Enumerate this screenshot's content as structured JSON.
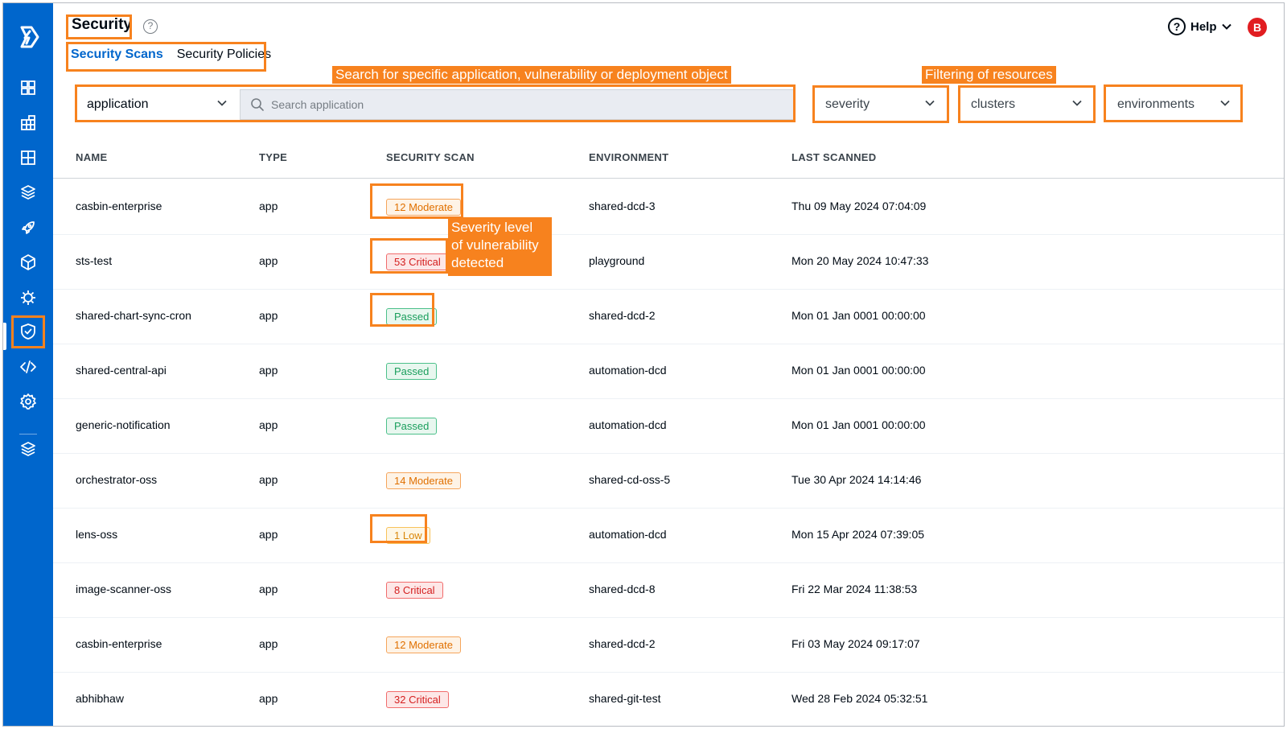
{
  "header": {
    "title": "Security",
    "help_label": "Help",
    "avatar_initial": "B"
  },
  "tabs": [
    {
      "label": "Security Scans",
      "active": true
    },
    {
      "label": "Security Policies",
      "active": false
    }
  ],
  "search": {
    "scope_value": "application",
    "placeholder": "Search application"
  },
  "filters": {
    "severity": "severity",
    "clusters": "clusters",
    "environments": "environments"
  },
  "annotations": {
    "search": "Search for specific application, vulnerability or deployment object",
    "filtering": "Filtering of resources",
    "severity_line1": "Severity level",
    "severity_line2": "of vulnerability",
    "severity_line3": "detected"
  },
  "table": {
    "columns": [
      "NAME",
      "TYPE",
      "SECURITY SCAN",
      "ENVIRONMENT",
      "LAST SCANNED"
    ],
    "rows": [
      {
        "name": "casbin-enterprise",
        "type": "app",
        "scan": "12 Moderate",
        "scan_level": "moderate",
        "environment": "shared-dcd-3",
        "last_scanned": "Thu 09 May 2024 07:04:09"
      },
      {
        "name": "sts-test",
        "type": "app",
        "scan": "53 Critical",
        "scan_level": "critical",
        "environment": "playground",
        "last_scanned": "Mon 20 May 2024 10:47:33"
      },
      {
        "name": "shared-chart-sync-cron",
        "type": "app",
        "scan": "Passed",
        "scan_level": "passed",
        "environment": "shared-dcd-2",
        "last_scanned": "Mon 01 Jan 0001 00:00:00"
      },
      {
        "name": "shared-central-api",
        "type": "app",
        "scan": "Passed",
        "scan_level": "passed",
        "environment": "automation-dcd",
        "last_scanned": "Mon 01 Jan 0001 00:00:00"
      },
      {
        "name": "generic-notification",
        "type": "app",
        "scan": "Passed",
        "scan_level": "passed",
        "environment": "automation-dcd",
        "last_scanned": "Mon 01 Jan 0001 00:00:00"
      },
      {
        "name": "orchestrator-oss",
        "type": "app",
        "scan": "14 Moderate",
        "scan_level": "moderate",
        "environment": "shared-cd-oss-5",
        "last_scanned": "Tue 30 Apr 2024 14:14:46"
      },
      {
        "name": "lens-oss",
        "type": "app",
        "scan": "1 Low",
        "scan_level": "low",
        "environment": "automation-dcd",
        "last_scanned": "Mon 15 Apr 2024 07:39:05"
      },
      {
        "name": "image-scanner-oss",
        "type": "app",
        "scan": "8 Critical",
        "scan_level": "critical",
        "environment": "shared-dcd-8",
        "last_scanned": "Fri 22 Mar 2024 11:38:53"
      },
      {
        "name": "casbin-enterprise",
        "type": "app",
        "scan": "12 Moderate",
        "scan_level": "moderate",
        "environment": "shared-dcd-2",
        "last_scanned": "Fri 03 May 2024 09:17:07"
      },
      {
        "name": "abhibhaw",
        "type": "app",
        "scan": "32 Critical",
        "scan_level": "critical",
        "environment": "shared-git-test",
        "last_scanned": "Wed 28 Feb 2024 05:32:51"
      }
    ]
  },
  "sidebar": {
    "items": [
      {
        "icon": "app-grid-icon"
      },
      {
        "icon": "chart-store-icon"
      },
      {
        "icon": "app-groups-icon"
      },
      {
        "icon": "stack-icon"
      },
      {
        "icon": "rocket-icon"
      },
      {
        "icon": "package-icon"
      },
      {
        "icon": "bug-icon"
      },
      {
        "icon": "shield-icon",
        "active": true
      },
      {
        "icon": "code-icon"
      },
      {
        "icon": "gear-icon"
      },
      {
        "icon": "layers-icon"
      }
    ]
  },
  "colors": {
    "sidebar_bg": "#0066cc",
    "accent": "#0066cc",
    "annotation": "#f7821e",
    "critical": "#d41f1f",
    "moderate": "#e07000",
    "passed": "#1a9e5c",
    "low": "#d9870a"
  }
}
